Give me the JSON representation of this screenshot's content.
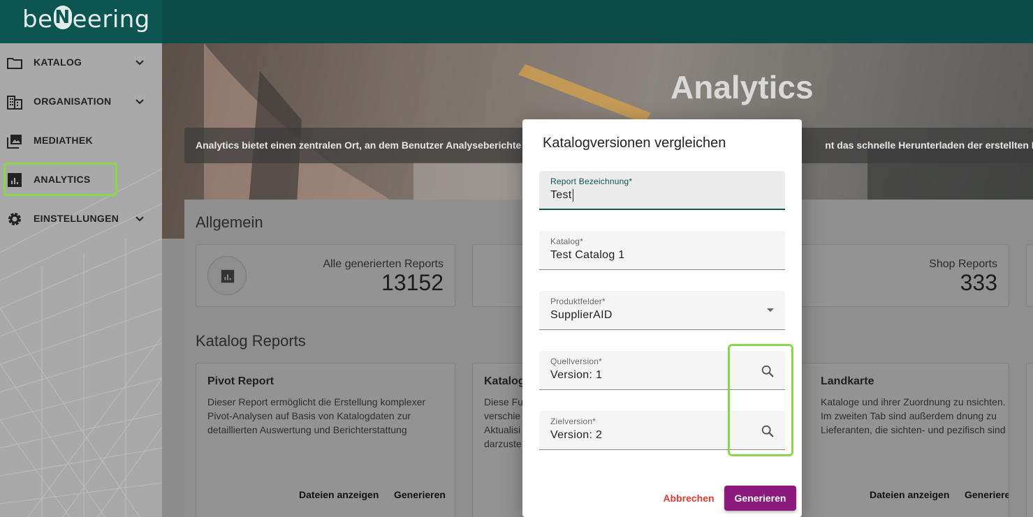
{
  "brand": {
    "name_pre": "be",
    "name_mid": "N",
    "name_post": "eering"
  },
  "sidebar": {
    "items": [
      {
        "label": "KATALOG",
        "icon": "folder-icon",
        "has_chevron": true
      },
      {
        "label": "ORGANISATION",
        "icon": "building-icon",
        "has_chevron": true
      },
      {
        "label": "MEDIATHEK",
        "icon": "photo-library-icon",
        "has_chevron": false
      },
      {
        "label": "ANALYTICS",
        "icon": "analytics-icon",
        "has_chevron": false,
        "active": true
      },
      {
        "label": "EINSTELLUNGEN",
        "icon": "gear-icon",
        "has_chevron": true
      }
    ]
  },
  "hero": {
    "title": "Analytics",
    "description": "Analytics bietet einen zentralen Ort, an dem Benutzer Analyseberichte ers",
    "description_tail": "nt das schnelle Herunterladen der erstellten Dateien"
  },
  "general": {
    "title": "Allgemein",
    "stats": [
      {
        "label": "Alle generierten Reports",
        "value": "13152"
      },
      {
        "label": "Shop Reports",
        "value": "333"
      }
    ]
  },
  "catalog_reports": {
    "title": "Katalog Reports",
    "cards": [
      {
        "title": "Pivot Report",
        "description": "Dieser Report ermöglicht die Erstellung komplexer Pivot-Analysen auf Basis von Katalogdaten zur detaillierten Auswertung und Berichterstattung",
        "show_files": "Dateien anzeigen",
        "generate": "Generieren"
      },
      {
        "title": "Katalog",
        "description": "Diese Fu verschie Aktualisi darzuste",
        "show_files": "",
        "generate": ""
      },
      {
        "title": "Landkarte",
        "description": "Kataloge und ihrer Zuordnung zu nsichten. Im zweiten Tab sind außerdem dnung zu Lieferanten, die sichten- und pezifisch sind",
        "show_files": "Dateien anzeigen",
        "generate": "Generieren"
      }
    ]
  },
  "dialog": {
    "title": "Katalogversionen vergleichen",
    "fields": {
      "report_name": {
        "label": "Report Bezeichnung*",
        "value": "Test"
      },
      "catalog": {
        "label": "Katalog*",
        "value": "Test Catalog 1"
      },
      "product_fields": {
        "label": "Produktfelder*",
        "value": "SupplierAID"
      },
      "source_version": {
        "label": "Quellversion*",
        "value": "Version: 1"
      },
      "target_version": {
        "label": "Zielversion*",
        "value": "Version: 2"
      }
    },
    "cancel_label": "Abbrechen",
    "generate_label": "Generieren"
  },
  "colors": {
    "topbar": "#0b4c48",
    "accent_button": "#8c1a7c",
    "cancel_text": "#e53935",
    "highlight": "#8dd64a"
  }
}
